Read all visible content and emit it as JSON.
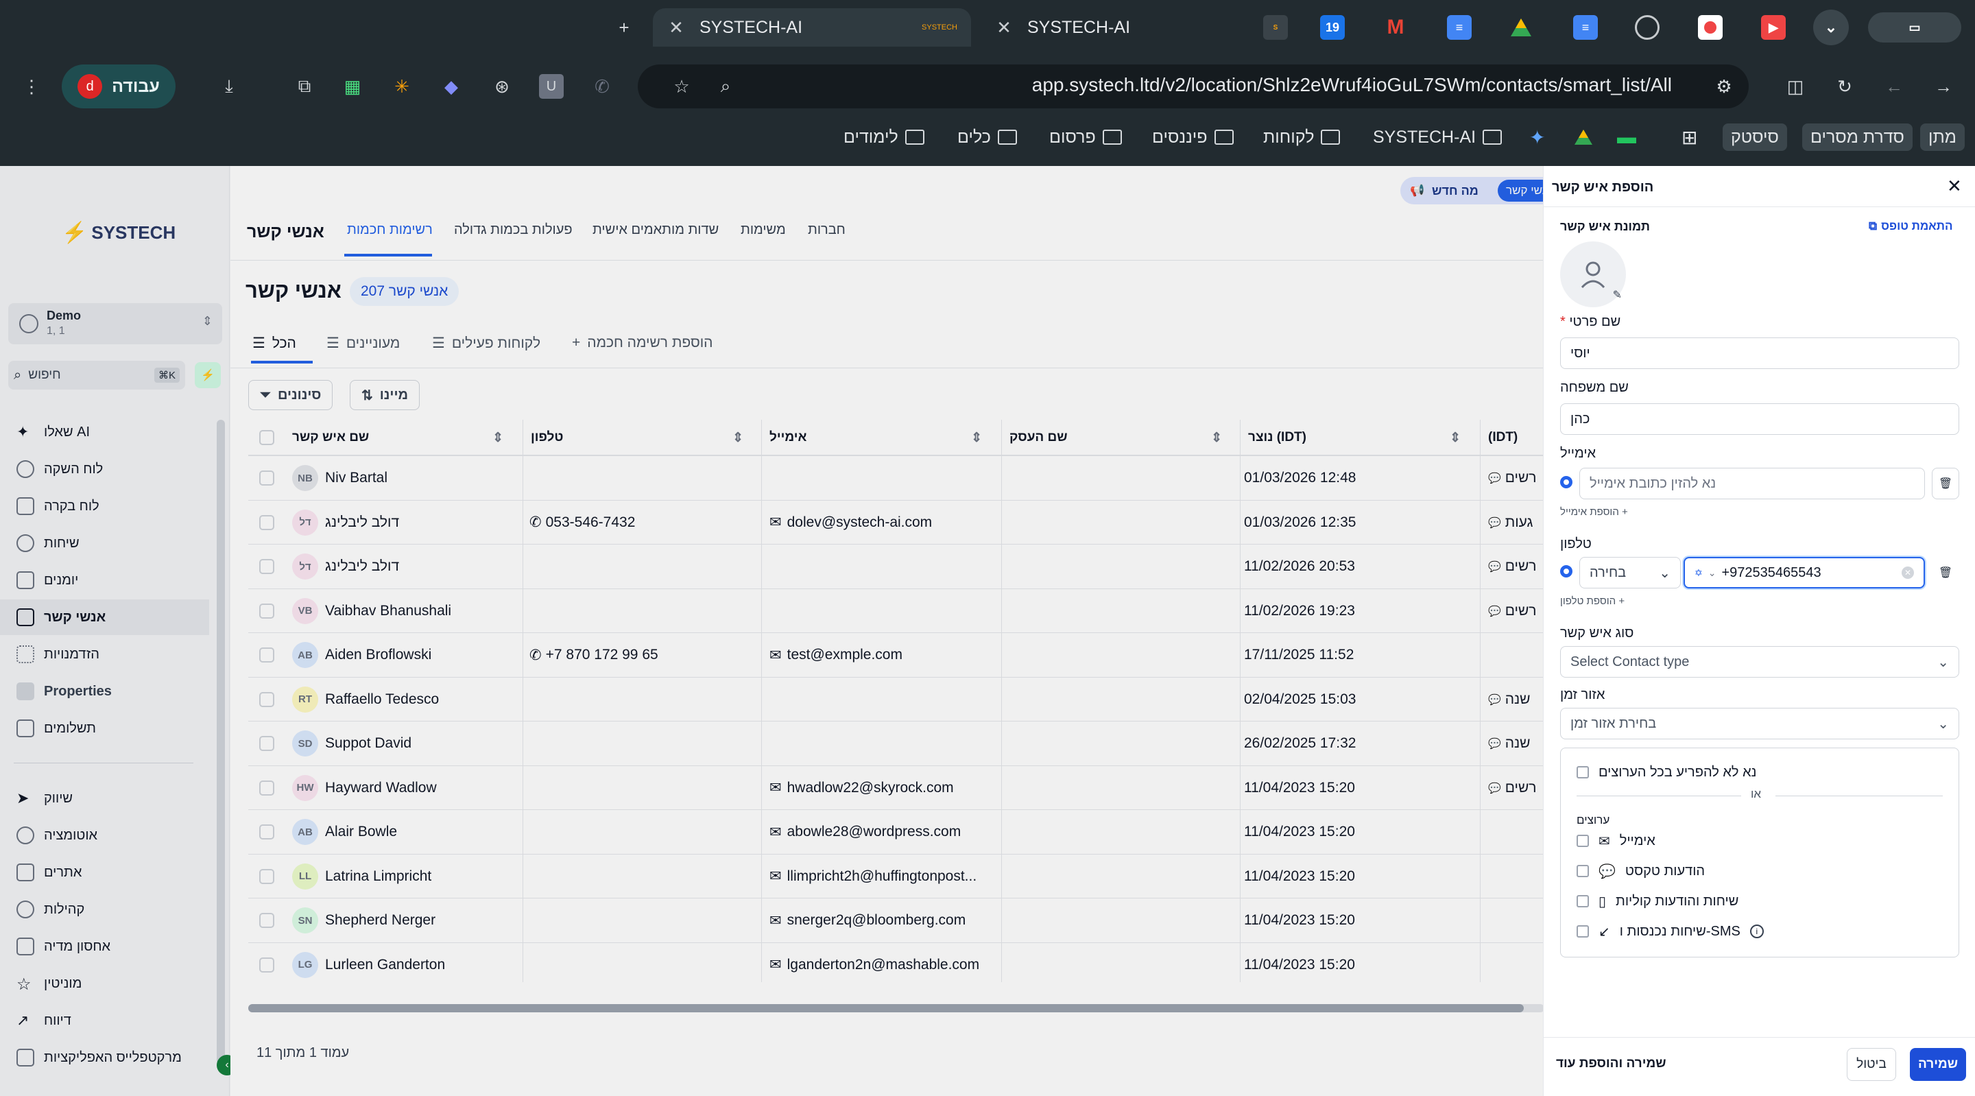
{
  "browser": {
    "tabs": [
      {
        "title": "SYSTECH-AI",
        "favicon": "SYSTECH"
      },
      {
        "title": "SYSTECH-AI"
      }
    ],
    "new_tab": "+",
    "url": "app.systech.ltd/v2/location/Shlz2eWruf4ioGuL7SWm/contacts/smart_list/All",
    "profile_label": "עבודה",
    "profile_initial": "d",
    "calendar_pin": "19",
    "extension_u": "U",
    "bookmarks": [
      "מתן",
      "סדרת מסרים",
      "סיסטק",
      "SYSTECH-AI",
      "לקוחות",
      "פיננסים",
      "פרסום",
      "כלים",
      "לימודים"
    ]
  },
  "sidebar": {
    "logo_text": "SYSTECH",
    "account": {
      "name": "Demo",
      "sub": "1, 1"
    },
    "search_placeholder": "חיפוש",
    "search_shortcut": "⌘K",
    "items": [
      {
        "label": "שאלו AI",
        "icon": "sparkles-icon"
      },
      {
        "label": "לוח השקה",
        "icon": "rocket-icon"
      },
      {
        "label": "לוח בקרה",
        "icon": "dashboard-icon"
      },
      {
        "label": "שיחות",
        "icon": "chat-icon"
      },
      {
        "label": "יומנים",
        "icon": "calendar-icon"
      },
      {
        "label": "אנשי קשר",
        "icon": "contacts-icon"
      },
      {
        "label": "הזדמנויות",
        "icon": "opportunities-icon"
      },
      {
        "label": "Properties",
        "icon": "home-icon"
      },
      {
        "label": "תשלומים",
        "icon": "receipt-icon"
      },
      {
        "label": "שיווק",
        "icon": "send-icon"
      },
      {
        "label": "אוטומציה",
        "icon": "automation-icon"
      },
      {
        "label": "אתרים",
        "icon": "globe-icon"
      },
      {
        "label": "קהילות",
        "icon": "community-icon"
      },
      {
        "label": "אחסון מדיה",
        "icon": "image-icon"
      },
      {
        "label": "מוניטין",
        "icon": "star-icon"
      },
      {
        "label": "דיווח",
        "icon": "chart-icon"
      },
      {
        "label": "מרקטפלייס האפליקציות",
        "icon": "apps-icon"
      }
    ]
  },
  "main": {
    "top_tabs": [
      "אנשי קשר",
      "רשימות חכמות",
      "פעולות בכמות גדולה",
      "שדות מותאמים אישית",
      "משימות",
      "חברות"
    ],
    "top_buttons": {
      "whats_new": "מה חדש",
      "contacts": "אנשי קשר"
    },
    "page_title": "אנשי קשר",
    "count_badge": "207 אנשי קשר",
    "filter_tabs": [
      "הכל",
      "מעוניינים",
      "לקוחות פעילים",
      "הוספת רשימה חכמה"
    ],
    "sort_label": "מיינו",
    "filters_label": "סינונים",
    "columns": [
      "שם איש קשר",
      "טלפון",
      "אימייל",
      "שם העסק",
      "נוצר (IDT)",
      "(IDT)"
    ],
    "rows": [
      {
        "initials": "NB",
        "name": "Niv Bartal",
        "phone": "",
        "email": "",
        "created": "01/03/2026 12:48",
        "tag": "רשים",
        "avatar_color": "#e5e7eb"
      },
      {
        "initials": "דל",
        "name": "דולב ליבלינג",
        "phone": "053-546-7432",
        "email": "dolev@systech-ai.com",
        "created": "01/03/2026 12:35",
        "tag": "געות",
        "avatar_color": "#fce7f3"
      },
      {
        "initials": "דל",
        "name": "דולב ליבלינג",
        "phone": "",
        "email": "",
        "created": "11/02/2026 20:53",
        "tag": "רשים",
        "avatar_color": "#fce7f3"
      },
      {
        "initials": "VB",
        "name": "Vaibhav Bhanushali",
        "phone": "",
        "email": "",
        "created": "11/02/2026 19:23",
        "tag": "רשים",
        "avatar_color": "#fce7f3"
      },
      {
        "initials": "AB",
        "name": "Aiden Broflowski",
        "phone": "+7 870 172 99 65",
        "email": "test@exmple.com",
        "created": "17/11/2025 11:52",
        "tag": "",
        "avatar_color": "#dbeafe"
      },
      {
        "initials": "RT",
        "name": "Raffaello Tedesco",
        "phone": "",
        "email": "",
        "created": "02/04/2025 15:03",
        "tag": "שנה",
        "avatar_color": "#fef9c3"
      },
      {
        "initials": "SD",
        "name": "Suppot David",
        "phone": "",
        "email": "",
        "created": "26/02/2025 17:32",
        "tag": "שנה",
        "avatar_color": "#dbeafe"
      },
      {
        "initials": "HW",
        "name": "Hayward Wadlow",
        "phone": "",
        "email": "hwadlow22@skyrock.com",
        "created": "11/04/2023 15:20",
        "tag": "רשים",
        "avatar_color": "#fce7f3"
      },
      {
        "initials": "AB",
        "name": "Alair Bowle",
        "phone": "",
        "email": "abowle28@wordpress.com",
        "created": "11/04/2023 15:20",
        "tag": "",
        "avatar_color": "#dbeafe"
      },
      {
        "initials": "LL",
        "name": "Latrina Limpricht",
        "phone": "",
        "email": "llimpricht2h@huffingtonpost...",
        "created": "11/04/2023 15:20",
        "tag": "",
        "avatar_color": "#ecfccb"
      },
      {
        "initials": "SN",
        "name": "Shepherd Nerger",
        "phone": "",
        "email": "snerger2q@bloomberg.com",
        "created": "11/04/2023 15:20",
        "tag": "",
        "avatar_color": "#dcfce7"
      },
      {
        "initials": "LG",
        "name": "Lurleen Ganderton",
        "phone": "",
        "email": "lganderton2n@mashable.com",
        "created": "11/04/2023 15:20",
        "tag": "",
        "avatar_color": "#dbeafe"
      }
    ],
    "pagination": "עמוד 1 מתוך 11"
  },
  "panel": {
    "title": "הוספת איש קשר",
    "photo_label": "תמונת איש קשר",
    "form_link": "התאמת טופס",
    "first_name_label": "שם פרטי",
    "required_mark": "*",
    "first_name_value": "יוסי",
    "last_name_label": "שם משפחה",
    "last_name_value": "כהן",
    "email_label": "אימייל",
    "email_placeholder": "נא להזין כתובת אימייל",
    "add_email": "הוספת אימייל +",
    "phone_label": "טלפון",
    "phone_type": "בחירה",
    "phone_value": "+972535465543",
    "add_phone": "הוספת טלפון +",
    "contact_type_label": "סוג איש קשר",
    "contact_type_placeholder": "Select Contact type",
    "timezone_label": "אזור זמן",
    "timezone_placeholder": "בחירת אזור זמן",
    "dnd_all": "נא לא להפריע בכל הערוצים",
    "or": "או",
    "channels_label": "ערוצים",
    "channels": [
      "אימייל",
      "הודעות טקסט",
      "שיחות והודעות קוליות",
      "שיחות נכנסות ו-SMS"
    ],
    "save": "שמירה",
    "cancel": "ביטול",
    "save_add_more": "שמירה והוספת עוד"
  }
}
